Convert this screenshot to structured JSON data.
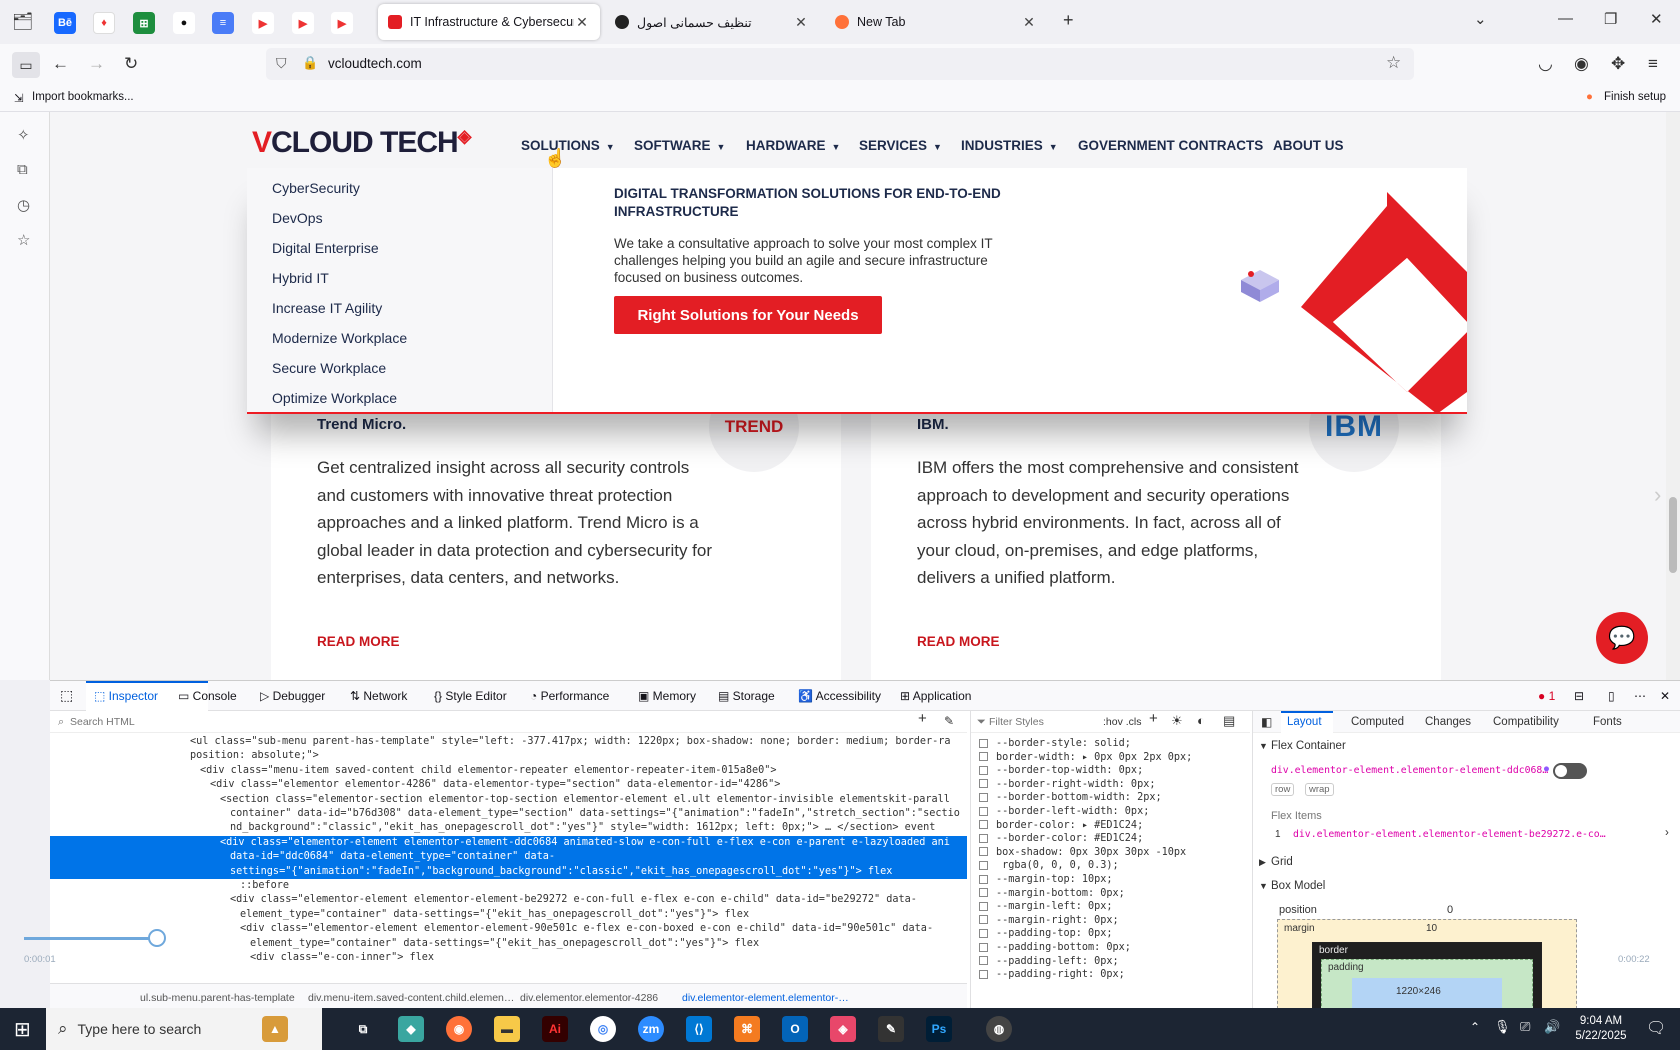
{
  "browser": {
    "tabs": [
      {
        "title": "IT Infrastructure & Cybersecurit",
        "active": true
      },
      {
        "title": "تنظیف حسمانی اصول",
        "active": false
      },
      {
        "title": "New Tab",
        "active": false
      }
    ],
    "url": "vcloudtech.com",
    "bookmarks": {
      "import_label": "Import bookmarks...",
      "finish_setup": "Finish setup"
    }
  },
  "site": {
    "logo": {
      "v": "V",
      "rest": "CLOUD TECH"
    },
    "nav": [
      "SOLUTIONS",
      "SOFTWARE",
      "HARDWARE",
      "SERVICES",
      "INDUSTRIES",
      "GOVERNMENT CONTRACTS",
      "ABOUT US"
    ],
    "menu": {
      "items": [
        "CyberSecurity",
        "DevOps",
        "Digital Enterprise",
        "Hybrid IT",
        "Increase IT Agility",
        "Modernize Workplace",
        "Secure Workplace",
        "Optimize Workplace"
      ],
      "promo_title": "DIGITAL TRANSFORMATION SOLUTIONS FOR END-TO-END INFRASTRUCTURE",
      "promo_text": "We take a consultative approach to solve your most complex IT challenges helping you build an agile and secure infrastructure focused on business outcomes.",
      "promo_button": "Right Solutions for Your Needs"
    },
    "cards": [
      {
        "title": "Trend Micro.",
        "logo_text": "TREND",
        "text": "Get centralized insight across all security controls and customers with innovative threat protection approaches and a linked platform. Trend Micro is a global leader in data protection and cybersecurity for enterprises, data centers, and networks.",
        "link": "READ MORE"
      },
      {
        "title": "IBM.",
        "logo_text": "IBM",
        "text": "IBM offers the most comprehensive and consistent approach to development and security operations across hybrid environments. In fact, across all of your cloud, on-premises, and edge platforms, delivers a unified platform.",
        "link": "READ MORE"
      }
    ]
  },
  "devtools": {
    "tabs": [
      "Inspector",
      "Console",
      "Debugger",
      "Network",
      "Style Editor",
      "Performance",
      "Memory",
      "Storage",
      "Accessibility",
      "Application"
    ],
    "search_placeholder": "Search HTML",
    "filter_placeholder": "Filter Styles",
    "filter_tools": ":hov  .cls",
    "tree": [
      "<ul class=\"sub-menu parent-has-template\" style=\"left: -377.417px; width: 1220px; box-shadow: none; border: medium; border-ra",
      "  position: absolute;\">",
      "  <div class=\"menu-item saved-content child elementor-repeater elementor-repeater-item-015a8e0\">",
      "    <div class=\"elementor elementor-4286\" data-elementor-type=\"section\" data-elementor-id=\"4286\">",
      "      <section class=\"elementor-section elementor-top-section elementor-element el.ult elementor-invisible elementskit-parall",
      "      container\" data-id=\"b76d308\" data-element_type=\"section\" data-settings=\"{\"animation\":\"fadeIn\",\"stretch_section\":\"sectio",
      "      nd_background\":\"classic\",\"ekit_has_onepagescroll_dot\":\"yes\"}\" style=\"width: 1612px; left: 0px;\"> … </section>  event",
      "      <div class=\"elementor-element elementor-element-ddc0684 animated-slow e-con-full e-flex e-con e-parent e-lazyloaded ani",
      "      data-id=\"ddc0684\" data-element_type=\"container\" data-",
      "      settings=\"{\"animation\":\"fadeIn\",\"background_background\":\"classic\",\"ekit_has_onepagescroll_dot\":\"yes\"}\">  flex",
      "        ::before",
      "        <div class=\"elementor-element elementor-element-be29272 e-con-full e-flex e-con e-child\" data-id=\"be29272\" data-",
      "        element_type=\"container\" data-settings=\"{\"ekit_has_onepagescroll_dot\":\"yes\"}\">  flex",
      "          <div class=\"elementor-element elementor-element-90e501c e-flex e-con-boxed e-con e-child\" data-id=\"90e501c\" data-",
      "          element_type=\"container\" data-settings=\"{\"ekit_has_onepagescroll_dot\":\"yes\"}\">  flex",
      "            <div class=\"e-con-inner\">  flex"
    ],
    "breadcrumb": [
      "ul.sub-menu.parent-has-template",
      "div.menu-item.saved-content.child.elemen…",
      "div.elementor.elementor-4286",
      "div.elementor-element.elementor-…"
    ],
    "rules": [
      "--border-style: solid;",
      "border-width: ▸ 0px 0px 2px 0px;",
      "--border-top-width: 0px;",
      "--border-right-width: 0px;",
      "--border-bottom-width: 2px;",
      "--border-left-width: 0px;",
      "border-color: ▸ #ED1C24;",
      "--border-color: #ED1C24;",
      "box-shadow: 0px 30px 30px -10px",
      "      rgba(0, 0, 0, 0.3);",
      "--margin-top: 10px;",
      "--margin-bottom: 0px;",
      "--margin-left: 0px;",
      "--margin-right: 0px;",
      "--padding-top: 0px;",
      "--padding-bottom: 0px;",
      "--padding-left: 0px;",
      "--padding-right: 0px;"
    ],
    "layout_tabs": [
      "Layout",
      "Computed",
      "Changes",
      "Compatibility",
      "Fonts"
    ],
    "flex_container_label": "Flex Container",
    "flex_container_el": "div.elementor-element.elementor-element-ddc068…",
    "flex_badges": [
      "row",
      "wrap"
    ],
    "flex_items_label": "Flex Items",
    "flex_item_index": "1",
    "flex_item": "div.elementor-element.elementor-element-be29272.e-co…",
    "grid_label": "Grid",
    "box_model_label": "Box Model",
    "position_label": "position",
    "position_value": "0",
    "margin_label": "margin",
    "margin_top": "10",
    "border_label": "border",
    "padding_label": "padding",
    "content_size": "1220×246",
    "error_count": "1"
  },
  "video": {
    "time_start": "0:00:01",
    "time_end": "0:00:22",
    "progress": 0.06
  },
  "taskbar": {
    "search_placeholder": "Type here to search",
    "time": "9:04 AM",
    "date": "5/22/2025"
  },
  "colors": {
    "brand_red": "#ED1C24",
    "devtools_blue": "#0074e8",
    "nav_text": "#1d2a4a"
  }
}
